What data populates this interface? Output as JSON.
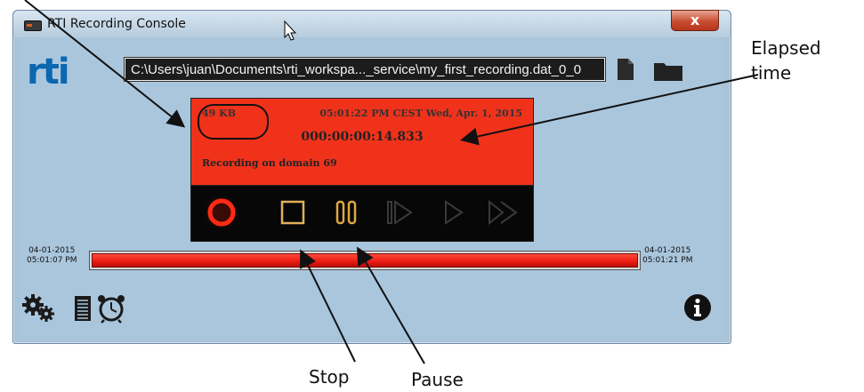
{
  "window": {
    "title": "RTI Recording Console",
    "close_label": "x"
  },
  "logo": {
    "text": "rti",
    "color": "#0b67b0"
  },
  "file_path": "C:\\Users\\juan\\Documents\\rti_workspa..._service\\my_first_recording.dat_0_0",
  "display": {
    "size": "49 KB",
    "datetime": "05:01:22 PM CEST  Wed, Apr. 1, 2015",
    "elapsed": "000:00:00:14.833",
    "status": "Recording on domain 69",
    "background": "#f1321b"
  },
  "controls": [
    {
      "name": "record-button",
      "icon": "record-icon",
      "state": "active"
    },
    {
      "name": "stop-button",
      "icon": "stop-icon",
      "state": "enabled"
    },
    {
      "name": "pause-button",
      "icon": "pause-icon",
      "state": "enabled"
    },
    {
      "name": "step-forward-button",
      "icon": "step-forward-icon",
      "state": "disabled"
    },
    {
      "name": "play-button",
      "icon": "play-icon",
      "state": "disabled"
    },
    {
      "name": "fast-forward-button",
      "icon": "fast-forward-icon",
      "state": "disabled"
    }
  ],
  "timeline": {
    "start_date": "04-01-2015",
    "start_time": "05:01:07 PM",
    "end_date": "04-01-2015",
    "end_time": "05:01:21 PM",
    "fill_fraction": 1.0,
    "fill_color": "#e81a12"
  },
  "bottom_icons": [
    "gears-icon",
    "list-icon",
    "alarm-clock-icon",
    "info-icon"
  ],
  "annotations": {
    "elapsed_line1": "Elapsed",
    "elapsed_line2": "time",
    "stop": "Stop",
    "pause": "Pause"
  }
}
